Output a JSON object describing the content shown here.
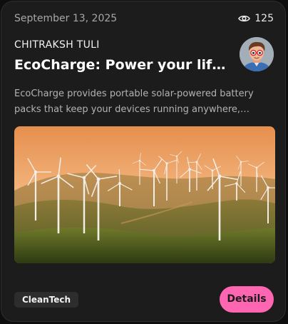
{
  "card": {
    "date": "September 13, 2025",
    "views": "125",
    "author": "CHITRAKSH TULI",
    "title": "EcoCharge: Power your life wit...",
    "description": "EcoCharge provides portable solar-powered battery packs that keep your devices running anywhere, anytime....",
    "tag": "CleanTech",
    "details_label": "Details",
    "icons": {
      "views": "eye-icon",
      "avatar": "avatar",
      "image": "wind-turbines-image"
    },
    "colors": {
      "card_bg": "#1c1c1c",
      "button_bg": "#ff66b2",
      "tag_bg": "#2d2d2d"
    }
  }
}
